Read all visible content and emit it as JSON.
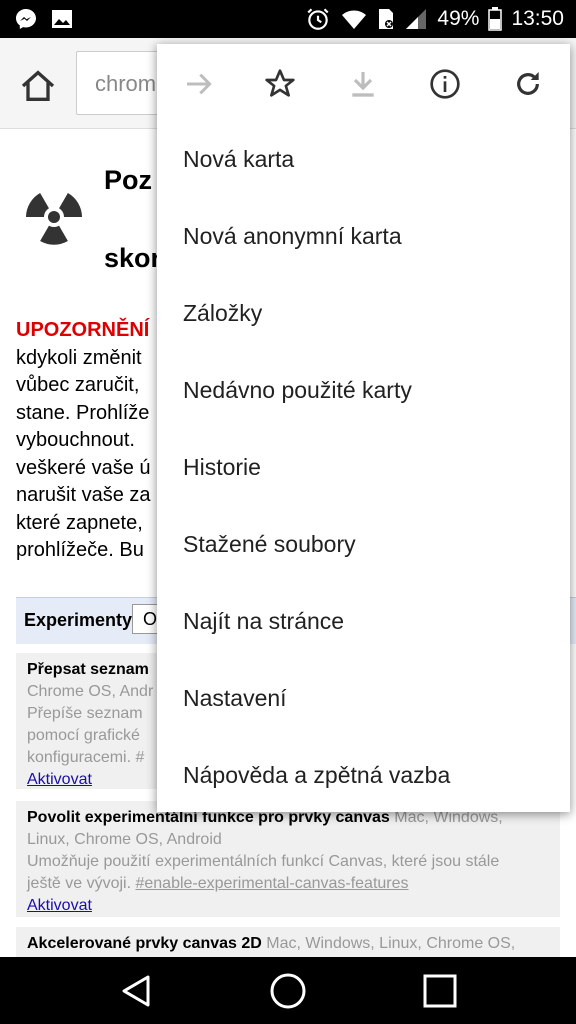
{
  "status_bar": {
    "battery_percent": "49%",
    "time": "13:50",
    "icons": [
      "messenger-icon",
      "gallery-icon",
      "alarm-icon",
      "wifi-icon",
      "sim-icon",
      "signal-icon",
      "battery-icon"
    ]
  },
  "toolbar": {
    "url_text": "chrom",
    "icons": [
      "home-icon"
    ]
  },
  "page": {
    "title_line1": "Poz",
    "title_line2": "skor",
    "warning_label": "UPOZORNĚNÍ",
    "warning_lines": [
      "kdykoli změnit",
      "vůbec zaručit,",
      "stane. Prohlíže",
      "vybouchnout. ",
      "veškeré vaše ú",
      "narušit vaše za",
      "které zapnete,",
      "prohlížeče. Bu"
    ],
    "experiments_label": "Experimenty",
    "experiments_select": "O",
    "experiments": [
      {
        "name": "Přepsat seznam",
        "platforms": "Chrome OS, Andr",
        "desc_lines": [
          "Přepíše seznam",
          "pomocí grafické",
          "konfiguracemi. #"
        ],
        "action": "Aktivovat"
      },
      {
        "name": "Povolit experimentální funkce pro prvky canvas",
        "platforms_inline": "Mac, Windows,",
        "platforms": "Linux, Chrome OS, Android",
        "desc_lines": [
          "Umožňuje použití experimentálních funkcí Canvas, které jsou stále"
        ],
        "desc_prefix": "ještě ve vývoji. ",
        "hash": "#enable-experimental-canvas-features",
        "action": "Aktivovat"
      },
      {
        "name": "Akcelerované prvky canvas 2D",
        "platforms_inline": "Mac, Windows, Linux, Chrome OS,"
      }
    ]
  },
  "menu": {
    "icons": [
      "forward-icon",
      "bookmark-star-icon",
      "download-icon",
      "info-icon",
      "refresh-icon"
    ],
    "items": [
      "Nová karta",
      "Nová anonymní karta",
      "Záložky",
      "Nedávno použité karty",
      "Historie",
      "Stažené soubory",
      "Najít na stránce",
      "Nastavení",
      "Nápověda a zpětná vazba"
    ]
  },
  "nav_bar": {
    "icons": [
      "back-icon",
      "home-circle-icon",
      "recents-icon"
    ]
  }
}
